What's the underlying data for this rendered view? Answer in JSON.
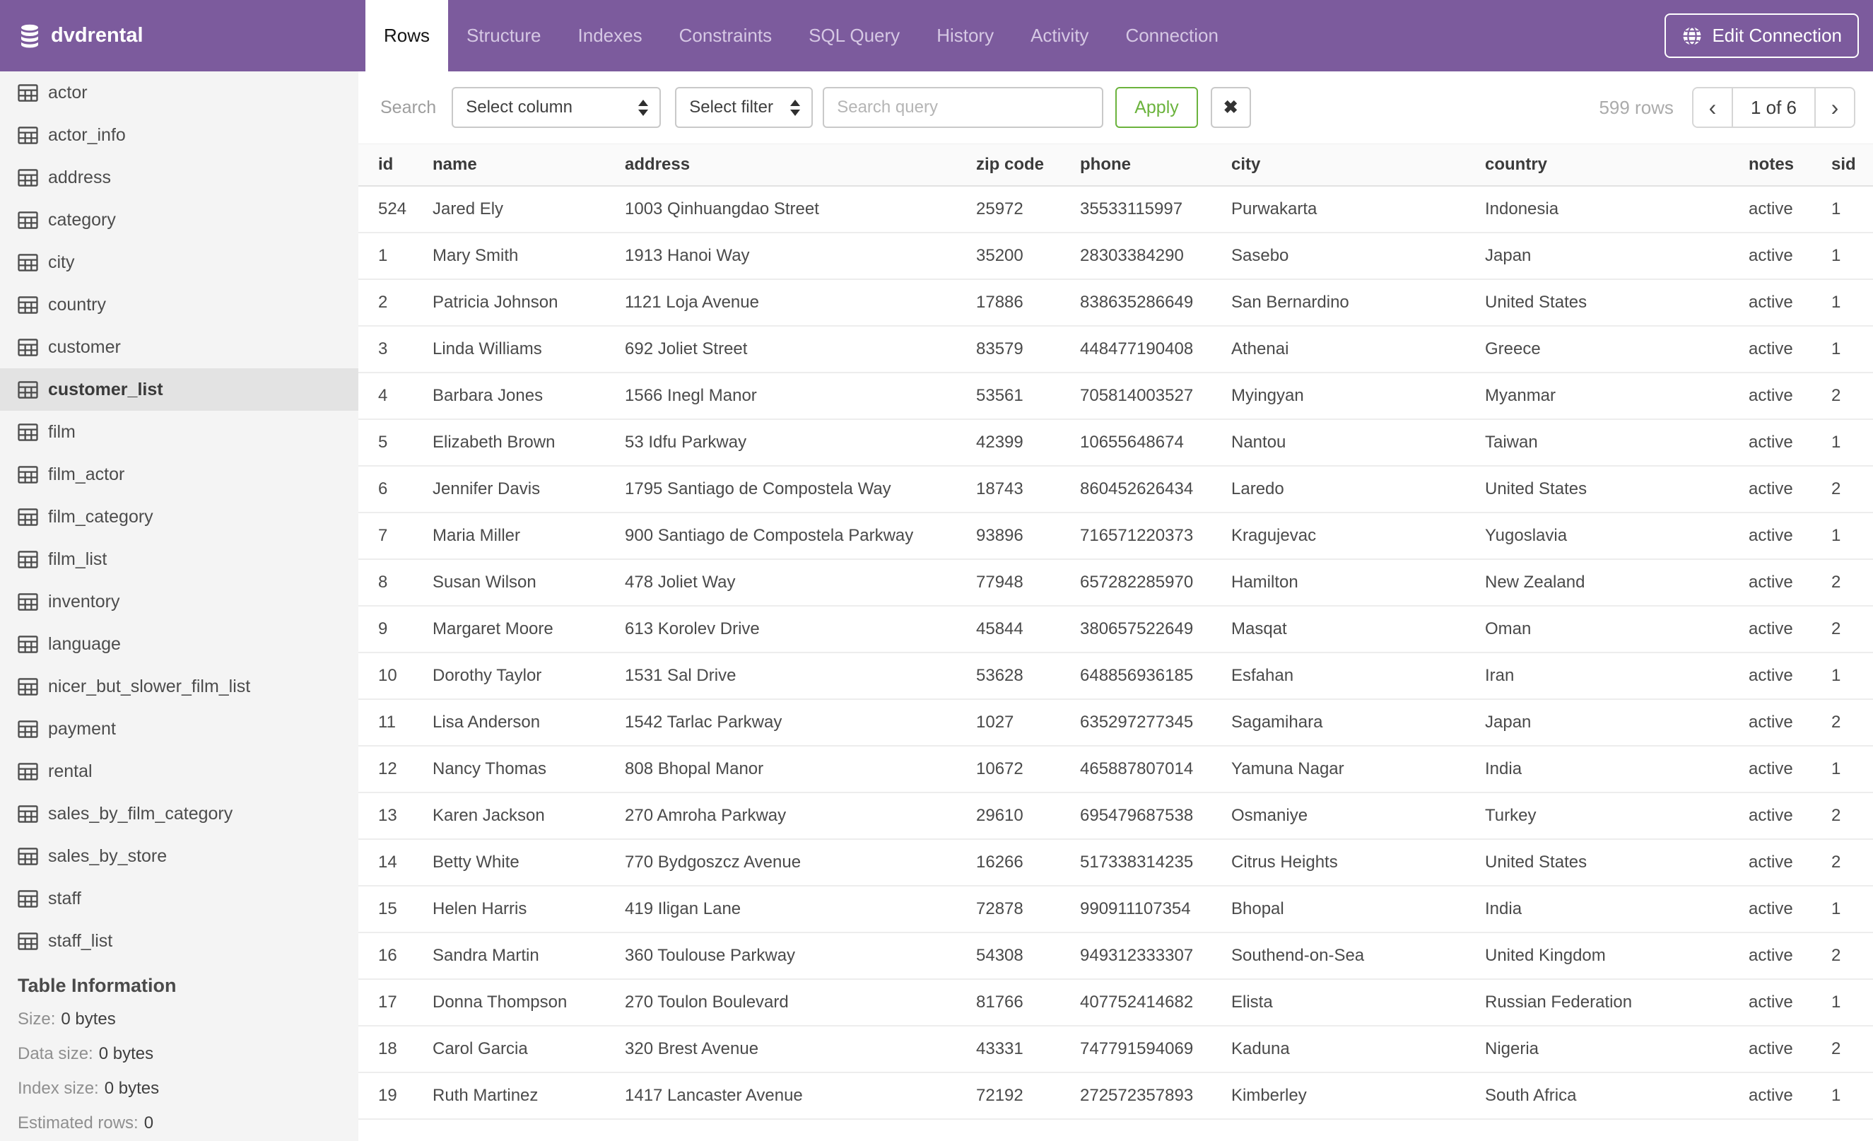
{
  "header": {
    "database_name": "dvdrental",
    "tabs": [
      "Rows",
      "Structure",
      "Indexes",
      "Constraints",
      "SQL Query",
      "History",
      "Activity",
      "Connection"
    ],
    "active_tab": "Rows",
    "edit_connection_label": "Edit Connection"
  },
  "toolbar": {
    "search_label": "Search",
    "column_select": "Select column",
    "filter_select": "Select filter",
    "query_placeholder": "Search query",
    "apply_label": "Apply",
    "clear_label": "✖",
    "rows_count": "599 rows",
    "pagination": {
      "prev": "‹",
      "page_label": "1 of 6",
      "next": "›"
    }
  },
  "sidebar": {
    "tables": [
      "actor",
      "actor_info",
      "address",
      "category",
      "city",
      "country",
      "customer",
      "customer_list",
      "film",
      "film_actor",
      "film_category",
      "film_list",
      "inventory",
      "language",
      "nicer_but_slower_film_list",
      "payment",
      "rental",
      "sales_by_film_category",
      "sales_by_store",
      "staff",
      "staff_list"
    ],
    "selected_table": "customer_list",
    "table_information": {
      "title": "Table Information",
      "stats": [
        {
          "label": "Size:",
          "value": "0 bytes"
        },
        {
          "label": "Data size:",
          "value": "0 bytes"
        },
        {
          "label": "Index size:",
          "value": "0 bytes"
        },
        {
          "label": "Estimated rows:",
          "value": "0"
        }
      ]
    }
  },
  "grid": {
    "columns": [
      "id",
      "name",
      "address",
      "zip code",
      "phone",
      "city",
      "country",
      "notes",
      "sid"
    ],
    "rows": [
      [
        "524",
        "Jared Ely",
        "1003 Qinhuangdao Street",
        "25972",
        "35533115997",
        "Purwakarta",
        "Indonesia",
        "active",
        "1"
      ],
      [
        "1",
        "Mary Smith",
        "1913 Hanoi Way",
        "35200",
        "28303384290",
        "Sasebo",
        "Japan",
        "active",
        "1"
      ],
      [
        "2",
        "Patricia Johnson",
        "1121 Loja Avenue",
        "17886",
        "838635286649",
        "San Bernardino",
        "United States",
        "active",
        "1"
      ],
      [
        "3",
        "Linda Williams",
        "692 Joliet Street",
        "83579",
        "448477190408",
        "Athenai",
        "Greece",
        "active",
        "1"
      ],
      [
        "4",
        "Barbara Jones",
        "1566 Inegl Manor",
        "53561",
        "705814003527",
        "Myingyan",
        "Myanmar",
        "active",
        "2"
      ],
      [
        "5",
        "Elizabeth Brown",
        "53 Idfu Parkway",
        "42399",
        "10655648674",
        "Nantou",
        "Taiwan",
        "active",
        "1"
      ],
      [
        "6",
        "Jennifer Davis",
        "1795 Santiago de Compostela Way",
        "18743",
        "860452626434",
        "Laredo",
        "United States",
        "active",
        "2"
      ],
      [
        "7",
        "Maria Miller",
        "900 Santiago de Compostela Parkway",
        "93896",
        "716571220373",
        "Kragujevac",
        "Yugoslavia",
        "active",
        "1"
      ],
      [
        "8",
        "Susan Wilson",
        "478 Joliet Way",
        "77948",
        "657282285970",
        "Hamilton",
        "New Zealand",
        "active",
        "2"
      ],
      [
        "9",
        "Margaret Moore",
        "613 Korolev Drive",
        "45844",
        "380657522649",
        "Masqat",
        "Oman",
        "active",
        "2"
      ],
      [
        "10",
        "Dorothy Taylor",
        "1531 Sal Drive",
        "53628",
        "648856936185",
        "Esfahan",
        "Iran",
        "active",
        "1"
      ],
      [
        "11",
        "Lisa Anderson",
        "1542 Tarlac Parkway",
        "1027",
        "635297277345",
        "Sagamihara",
        "Japan",
        "active",
        "2"
      ],
      [
        "12",
        "Nancy Thomas",
        "808 Bhopal Manor",
        "10672",
        "465887807014",
        "Yamuna Nagar",
        "India",
        "active",
        "1"
      ],
      [
        "13",
        "Karen Jackson",
        "270 Amroha Parkway",
        "29610",
        "695479687538",
        "Osmaniye",
        "Turkey",
        "active",
        "2"
      ],
      [
        "14",
        "Betty White",
        "770 Bydgoszcz Avenue",
        "16266",
        "517338314235",
        "Citrus Heights",
        "United States",
        "active",
        "2"
      ],
      [
        "15",
        "Helen Harris",
        "419 Iligan Lane",
        "72878",
        "990911107354",
        "Bhopal",
        "India",
        "active",
        "1"
      ],
      [
        "16",
        "Sandra Martin",
        "360 Toulouse Parkway",
        "54308",
        "949312333307",
        "Southend-on-Sea",
        "United Kingdom",
        "active",
        "2"
      ],
      [
        "17",
        "Donna Thompson",
        "270 Toulon Boulevard",
        "81766",
        "407752414682",
        "Elista",
        "Russian Federation",
        "active",
        "1"
      ],
      [
        "18",
        "Carol Garcia",
        "320 Brest Avenue",
        "43331",
        "747791594069",
        "Kaduna",
        "Nigeria",
        "active",
        "2"
      ],
      [
        "19",
        "Ruth Martinez",
        "1417 Lancaster Avenue",
        "72192",
        "272572357893",
        "Kimberley",
        "South Africa",
        "active",
        "1"
      ]
    ]
  }
}
